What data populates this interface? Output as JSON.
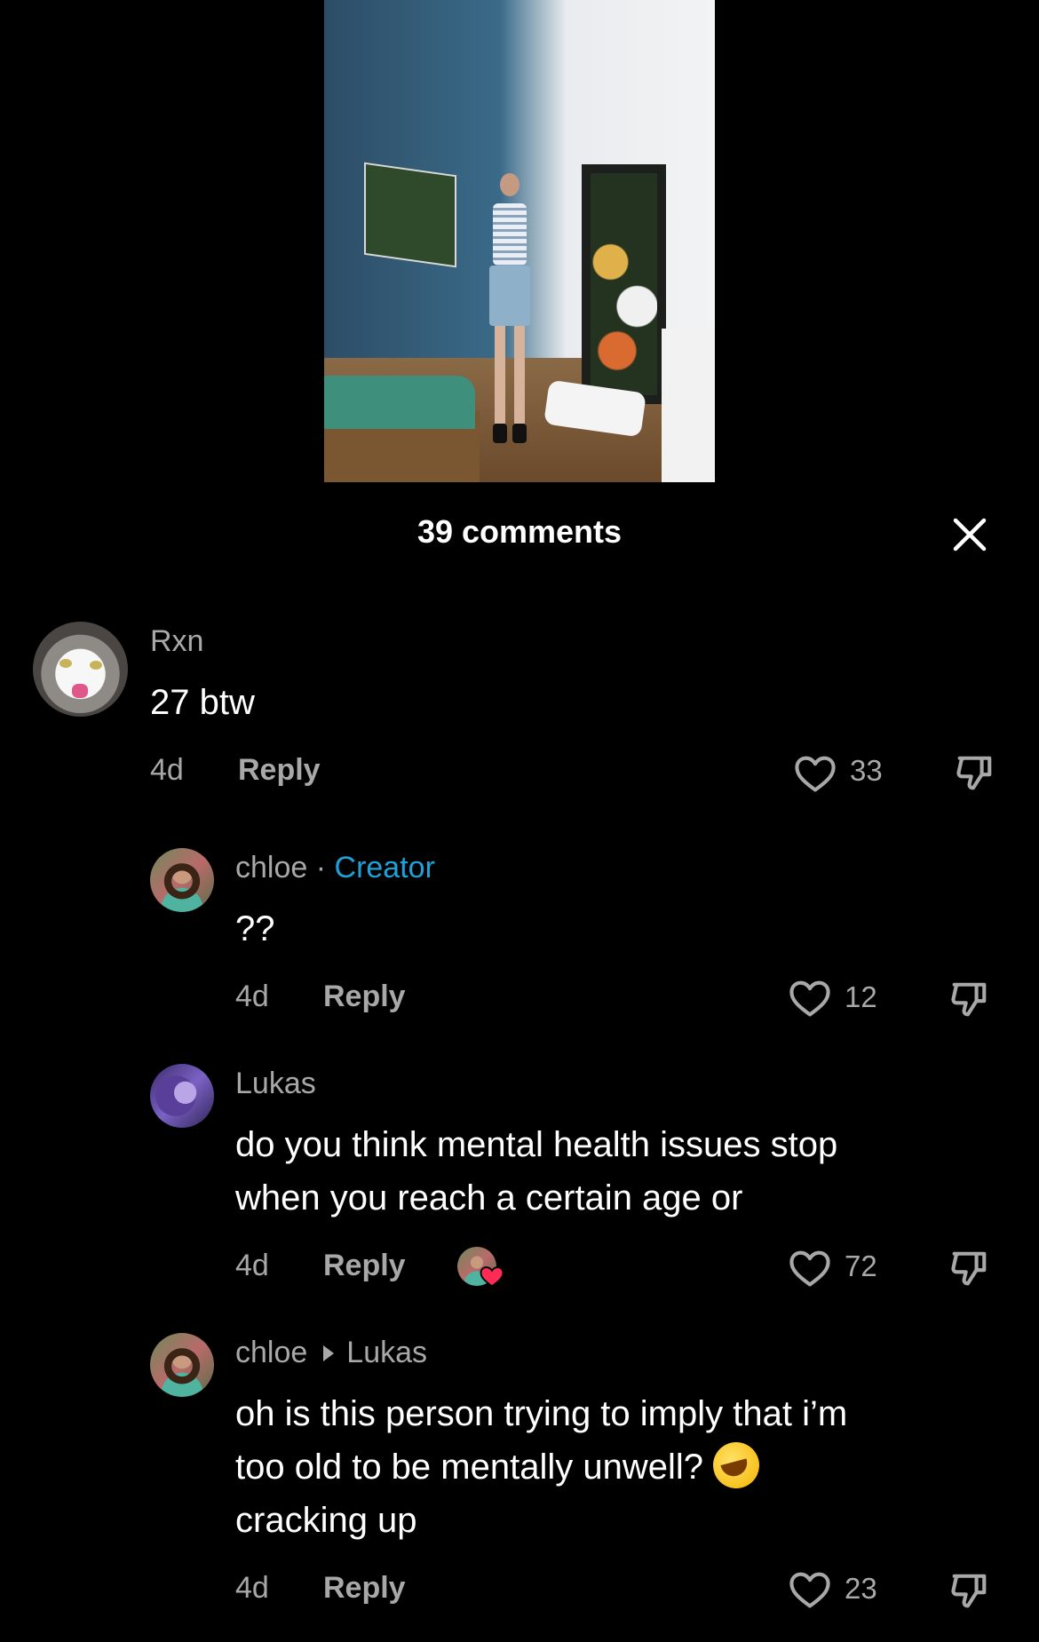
{
  "header": {
    "comments_count_label": "39 comments"
  },
  "comments": [
    {
      "username": "Rxn",
      "text": "27 btw",
      "age": "4d",
      "reply_label": "Reply",
      "likes": "33"
    },
    {
      "username": "chloe",
      "separator": "·",
      "badge": "Creator",
      "text": "??",
      "age": "4d",
      "reply_label": "Reply",
      "likes": "12"
    },
    {
      "username": "Lukas",
      "text_line1": "do you think mental health issues stop",
      "text_line2": "when you reach a certain age or",
      "age": "4d",
      "reply_label": "Reply",
      "likes": "72"
    },
    {
      "username": "chloe",
      "replying_to": "Lukas",
      "text_line1": "oh is this person trying to imply that i’m",
      "text_line2": "too old to be mentally unwell?",
      "text_line3": "cracking up",
      "age": "4d",
      "reply_label": "Reply",
      "likes": "23"
    }
  ],
  "icons": {
    "close": "close-icon",
    "like": "heart-outline-icon",
    "dislike": "thumbs-down-icon",
    "emoji": "rolling-on-floor-laughing-emoji",
    "creator_liked": "heart-badge-icon"
  },
  "colors": {
    "background": "#000000",
    "muted_text": "#a8a8a8",
    "creator_badge": "#1fa0d6",
    "heart_badge": "#fe2c55"
  }
}
